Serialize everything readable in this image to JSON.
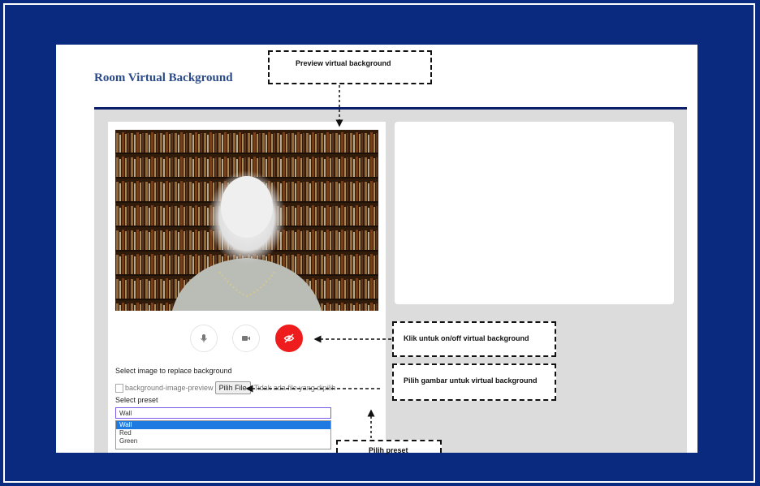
{
  "page": {
    "title": "Room Virtual Background"
  },
  "callouts": {
    "preview": "Preview virtual background",
    "toggle": "Klik untuk on/off virtual background",
    "image": "Pilih gambar untuk virtual background",
    "preset": "Pilih preset"
  },
  "controls": {
    "mic_icon": "microphone-icon",
    "camera_icon": "video-camera-icon",
    "vb_icon": "eye-off-icon",
    "vb_color": "#ee1c1c"
  },
  "form": {
    "image_label": "Select image to replace background",
    "image_alt": "background-image-preview",
    "file_button": "Pilih File",
    "file_status": "Tidak ada file yang dipilih",
    "preset_label": "Select preset",
    "preset_value": "Wall",
    "preset_options": [
      "Wall",
      "Red",
      "Green"
    ]
  }
}
